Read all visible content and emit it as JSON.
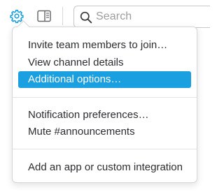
{
  "toolbar": {
    "icons": [
      "gear-icon",
      "sidebar-toggle-icon",
      "search-icon"
    ],
    "search_placeholder": "Search",
    "accent_color": "#1a9fe0"
  },
  "menu": {
    "groups": [
      {
        "items": [
          {
            "label": "Invite team members to join…"
          },
          {
            "label": "View channel details"
          },
          {
            "label": "Additional options…",
            "active": true
          }
        ]
      },
      {
        "items": [
          {
            "label": "Notification preferences…"
          },
          {
            "label": "Mute #announcements"
          }
        ]
      },
      {
        "items": [
          {
            "label": "Add an app or custom integration"
          }
        ]
      }
    ],
    "highlight_color": "#1a9fe0"
  }
}
